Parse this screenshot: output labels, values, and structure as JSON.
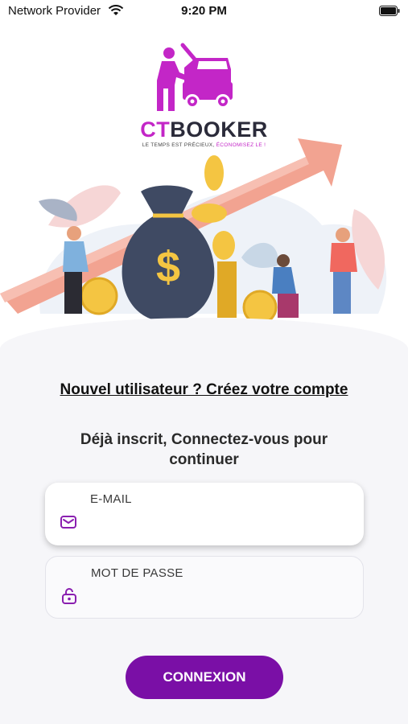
{
  "status_bar": {
    "carrier": "Network Provider",
    "time": "9:20 PM"
  },
  "brand": {
    "name_prefix": "CT",
    "name_suffix": "BOOKER",
    "tagline_start": "LE TEMPS EST PRÉCIEUX, ",
    "tagline_accent": "ÉCONOMISEZ LE !",
    "accent_color": "#c326c7"
  },
  "hero": {
    "icon": "money-bag-illustration"
  },
  "signup": {
    "link_label": "Nouvel utilisateur ? Créez votre compte"
  },
  "login": {
    "prompt": "Déjà inscrit, Connectez-vous pour continuer",
    "email": {
      "label": "E-MAIL",
      "value": "",
      "icon": "mail-icon"
    },
    "password": {
      "label": "MOT DE PASSE",
      "value": "",
      "icon": "lock-icon"
    },
    "submit_label": "CONNEXION",
    "button_color": "#7a0fa6"
  }
}
